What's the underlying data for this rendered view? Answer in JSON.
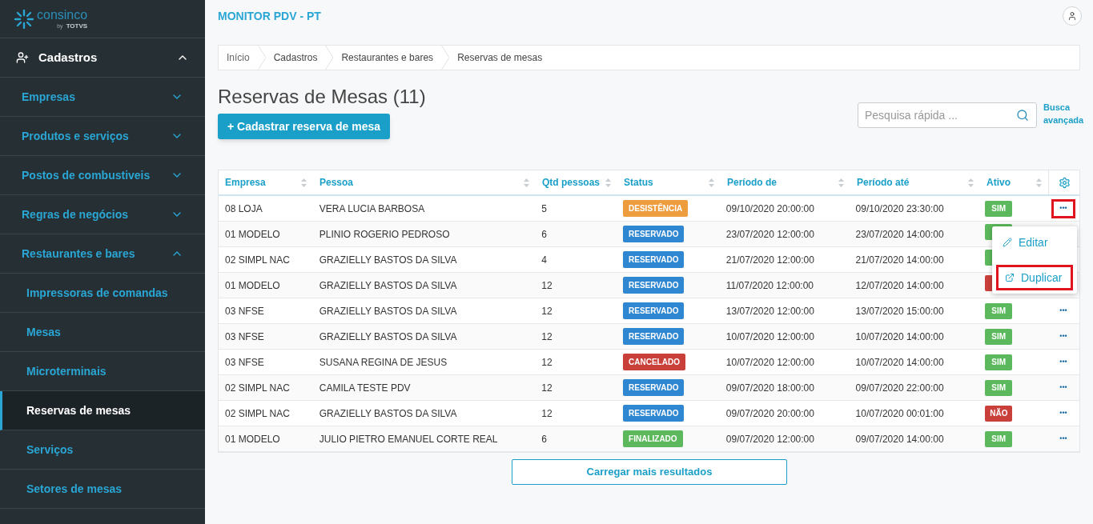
{
  "brand": {
    "name": "consinco",
    "byline": "by",
    "partner": "TOTVS"
  },
  "sidebar": {
    "section": {
      "label": "Cadastros",
      "expanded": true
    },
    "items": [
      {
        "label": "Empresas",
        "expanded": false
      },
      {
        "label": "Produtos e serviços",
        "expanded": false
      },
      {
        "label": "Postos de combustiveis",
        "expanded": false
      },
      {
        "label": "Regras de negócios",
        "expanded": false
      },
      {
        "label": "Restaurantes e bares",
        "expanded": true,
        "children": [
          {
            "label": "Impressoras de comandas",
            "selected": false
          },
          {
            "label": "Mesas",
            "selected": false
          },
          {
            "label": "Microterminais",
            "selected": false
          },
          {
            "label": "Reservas de mesas",
            "selected": true
          },
          {
            "label": "Serviços",
            "selected": false
          },
          {
            "label": "Setores de mesas",
            "selected": false
          }
        ]
      }
    ]
  },
  "header": {
    "title": "MONITOR PDV - PT"
  },
  "breadcrumb": [
    "Início",
    "Cadastros",
    "Restaurantes e bares",
    "Reservas de mesas"
  ],
  "page": {
    "title": "Reservas de Mesas (11)",
    "add_button": "+ Cadastrar reserva de mesa",
    "search": {
      "placeholder": "Pesquisa rápida ..."
    },
    "advanced_search": "Busca avançada"
  },
  "table": {
    "columns": [
      "Empresa",
      "Pessoa",
      "Qtd pessoas",
      "Status",
      "Período de",
      "Período até",
      "Ativo"
    ],
    "rows": [
      {
        "empresa": "08 LOJA",
        "pessoa": "VERA LUCIA BARBOSA",
        "qtd": "5",
        "status": {
          "text": "DESISTÊNCIA",
          "color": "#ee9d3e"
        },
        "de": "09/10/2020 20:00:00",
        "ate": "09/10/2020 23:30:00",
        "ativo": {
          "text": "SIM",
          "color": "#5cb85c"
        },
        "actions": {
          "text": "•••",
          "highlighted": true
        }
      },
      {
        "empresa": "01 MODELO",
        "pessoa": "PLINIO ROGERIO PEDROSO",
        "qtd": "6",
        "status": {
          "text": "RESERVADO",
          "color": "#2f86d1"
        },
        "de": "23/07/2020 12:00:00",
        "ate": "23/07/2020 14:00:00",
        "ativo": {
          "color": "#5cb85c"
        }
      },
      {
        "empresa": "02 SIMPL NAC",
        "pessoa": "GRAZIELLY BASTOS DA SILVA",
        "qtd": "4",
        "status": {
          "text": "RESERVADO",
          "color": "#2f86d1"
        },
        "de": "21/07/2020 12:00:00",
        "ate": "21/07/2020 14:00:00",
        "ativo": {
          "color": "#5cb85c"
        }
      },
      {
        "empresa": "01 MODELO",
        "pessoa": "GRAZIELLY BASTOS DA SILVA",
        "qtd": "12",
        "status": {
          "text": "RESERVADO",
          "color": "#2f86d1"
        },
        "de": "11/07/2020 12:00:00",
        "ate": "12/07/2020 14:00:00",
        "ativo": {
          "color": "#c9403a"
        }
      },
      {
        "empresa": "03 NFSE",
        "pessoa": "GRAZIELLY BASTOS DA SILVA",
        "qtd": "12",
        "status": {
          "text": "RESERVADO",
          "color": "#2f86d1"
        },
        "de": "13/07/2020 12:00:00",
        "ate": "13/07/2020 15:00:00",
        "ativo": {
          "text": "SIM",
          "color": "#5cb85c"
        },
        "actions": {
          "text": "•••",
          "highlighted": false
        }
      },
      {
        "empresa": "03 NFSE",
        "pessoa": "GRAZIELLY BASTOS DA SILVA",
        "qtd": "12",
        "status": {
          "text": "RESERVADO",
          "color": "#2f86d1"
        },
        "de": "10/07/2020 12:00:00",
        "ate": "10/07/2020 14:00:00",
        "ativo": {
          "text": "SIM",
          "color": "#5cb85c"
        },
        "actions": {
          "text": "•••",
          "highlighted": false
        }
      },
      {
        "empresa": "03 NFSE",
        "pessoa": "SUSANA REGINA DE JESUS",
        "qtd": "12",
        "status": {
          "text": "CANCELADO",
          "color": "#c9403a"
        },
        "de": "10/07/2020 12:00:00",
        "ate": "10/07/2020 14:00:00",
        "ativo": {
          "text": "SIM",
          "color": "#5cb85c"
        },
        "actions": {
          "text": "•••",
          "highlighted": false
        }
      },
      {
        "empresa": "02 SIMPL NAC",
        "pessoa": "CAMILA TESTE PDV",
        "qtd": "12",
        "status": {
          "text": "RESERVADO",
          "color": "#2f86d1"
        },
        "de": "09/07/2020 18:00:00",
        "ate": "09/07/2020 22:00:00",
        "ativo": {
          "text": "SIM",
          "color": "#5cb85c"
        },
        "actions": {
          "text": "•••",
          "highlighted": false
        }
      },
      {
        "empresa": "02 SIMPL NAC",
        "pessoa": "GRAZIELLY BASTOS DA SILVA",
        "qtd": "12",
        "status": {
          "text": "RESERVADO",
          "color": "#2f86d1"
        },
        "de": "09/07/2020 20:00:00",
        "ate": "10/07/2020 00:01:00",
        "ativo": {
          "text": "NÃO",
          "color": "#c9403a"
        },
        "actions": {
          "text": "•••",
          "highlighted": false
        }
      },
      {
        "empresa": "01 MODELO",
        "pessoa": "JULIO PIETRO EMANUEL CORTE REAL",
        "qtd": "6",
        "status": {
          "text": "FINALIZADO",
          "color": "#5cb85c"
        },
        "de": "09/07/2020 12:00:00",
        "ate": "09/07/2020 14:00:00",
        "ativo": {
          "text": "SIM",
          "color": "#5cb85c"
        },
        "actions": {
          "text": "•••",
          "highlighted": false
        }
      }
    ]
  },
  "menu": {
    "items": [
      {
        "kind": "edit",
        "label": "Editar",
        "highlighted": false
      },
      {
        "kind": "duplicate",
        "label": "Duplicar",
        "highlighted": true
      }
    ]
  },
  "load_more": "Carregar mais resultados"
}
